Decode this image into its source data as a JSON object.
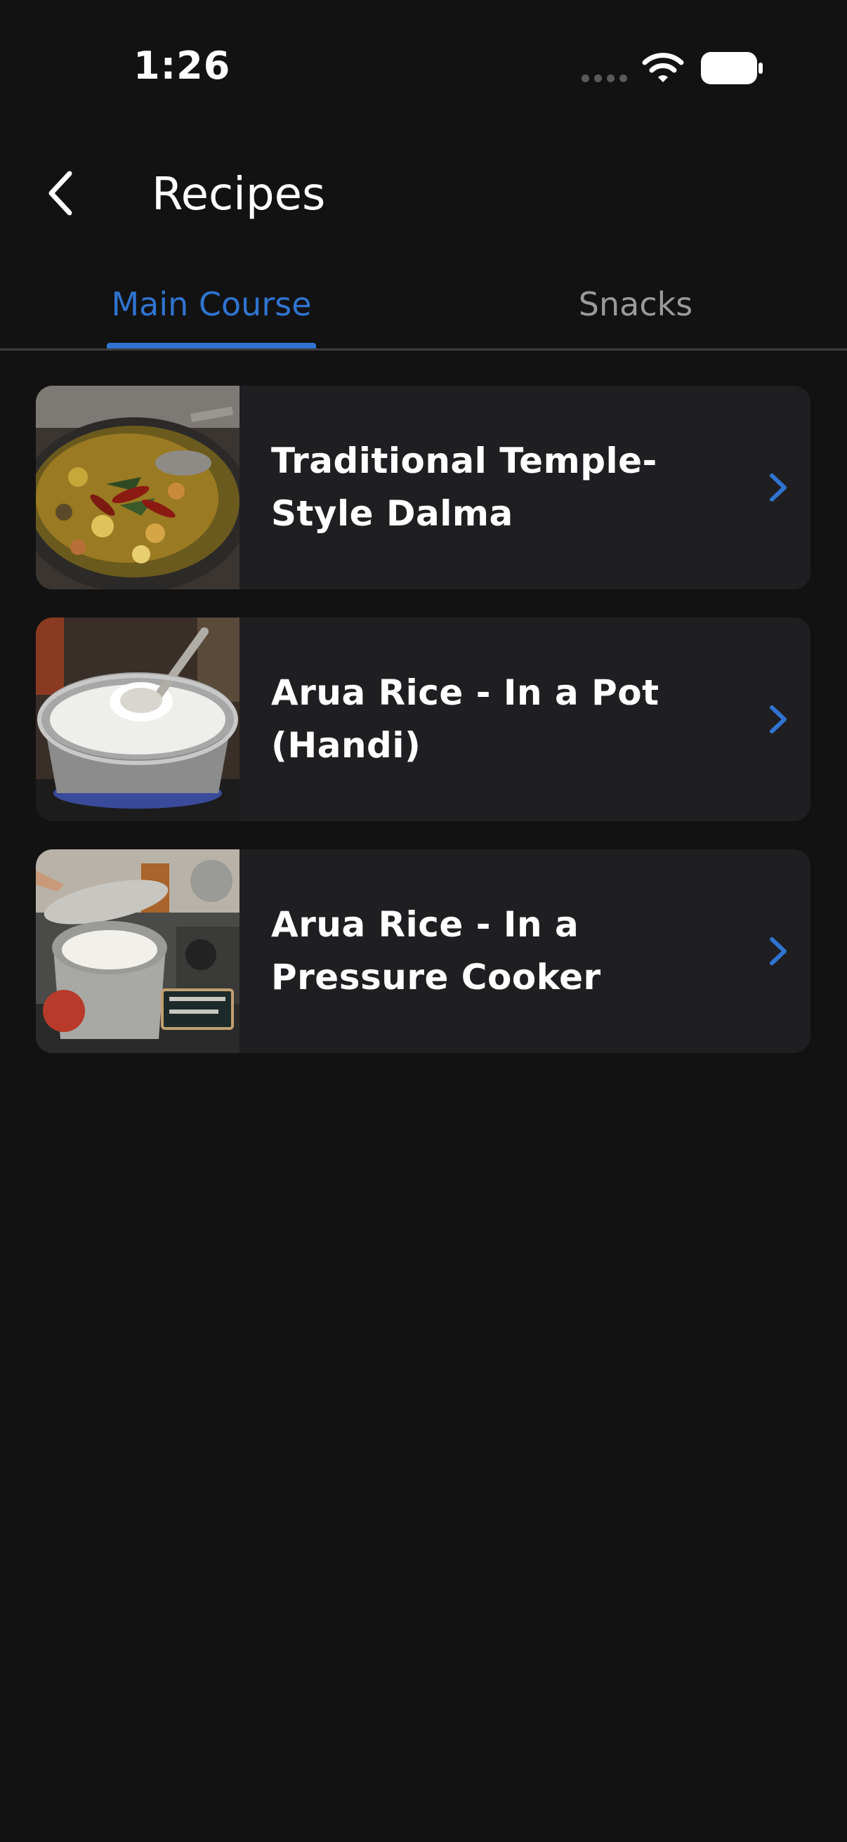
{
  "status_bar": {
    "time": "1:26"
  },
  "header": {
    "title": "Recipes",
    "back_icon": "chevron-left-icon"
  },
  "tabs": [
    {
      "label": "Main Course",
      "active": true
    },
    {
      "label": "Snacks",
      "active": false
    }
  ],
  "recipes": [
    {
      "title": "Traditional Temple-Style Dalma",
      "thumbnail": "dalma-curry-photo"
    },
    {
      "title": "Arua Rice - In a Pot (Handi)",
      "thumbnail": "rice-pot-photo"
    },
    {
      "title": "Arua Rice - In a Pressure Cooker",
      "thumbnail": "pressure-cooker-rice-photo"
    }
  ],
  "colors": {
    "background": "#121212",
    "card": "#1f1f21",
    "accent": "#2f74d0",
    "inactive_tab": "#9a9a9a"
  }
}
